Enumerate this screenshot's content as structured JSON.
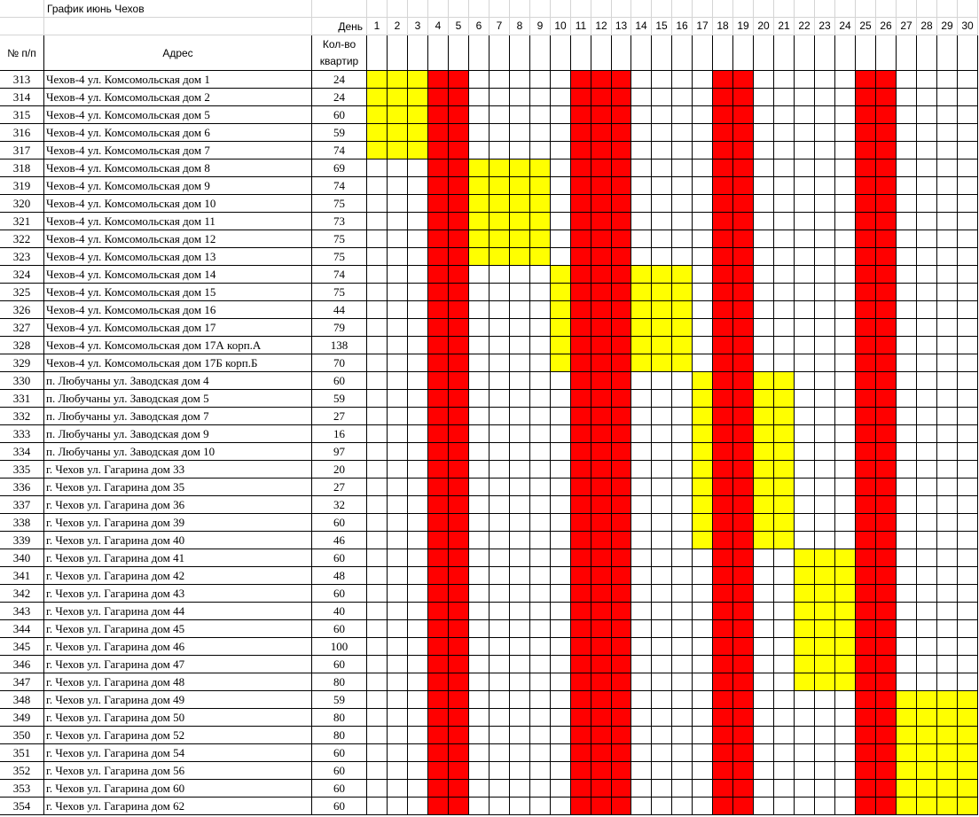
{
  "sheet": {
    "title": "График июнь Чехов",
    "header": {
      "day_label": "День",
      "num_label": "№ п/п",
      "address_label": "Адрес",
      "count_label_1": "Кол-во",
      "count_label_2": "квартир"
    },
    "days": [
      1,
      2,
      3,
      4,
      5,
      6,
      7,
      8,
      9,
      10,
      11,
      12,
      13,
      14,
      15,
      16,
      17,
      18,
      19,
      20,
      21,
      22,
      23,
      24,
      25,
      26,
      27,
      28,
      29,
      30
    ],
    "day_off_days": [
      4,
      5,
      11,
      12,
      13,
      18,
      19,
      25,
      26
    ],
    "colors": {
      "scheduled": "#ffff00",
      "day_off": "#ff0000",
      "gridline": "#d4d4d4",
      "border": "#000000"
    },
    "rows": [
      {
        "num": "313",
        "address": "Чехов-4 ул. Комсомольская дом 1",
        "count": "24",
        "days": [
          1,
          2,
          3
        ]
      },
      {
        "num": "314",
        "address": "Чехов-4 ул. Комсомольская дом 2",
        "count": "24",
        "days": [
          1,
          2,
          3
        ]
      },
      {
        "num": "315",
        "address": "Чехов-4 ул. Комсомольская дом 5",
        "count": "60",
        "days": [
          1,
          2,
          3
        ]
      },
      {
        "num": "316",
        "address": "Чехов-4 ул. Комсомольская дом 6",
        "count": "59",
        "days": [
          1,
          2,
          3
        ]
      },
      {
        "num": "317",
        "address": "Чехов-4 ул. Комсомольская дом 7",
        "count": "74",
        "days": [
          1,
          2,
          3
        ]
      },
      {
        "num": "318",
        "address": "Чехов-4 ул. Комсомольская дом 8",
        "count": "69",
        "days": [
          6,
          7,
          8,
          9
        ]
      },
      {
        "num": "319",
        "address": "Чехов-4 ул. Комсомольская дом 9",
        "count": "74",
        "days": [
          6,
          7,
          8,
          9
        ]
      },
      {
        "num": "320",
        "address": "Чехов-4 ул. Комсомольская дом 10",
        "count": "75",
        "days": [
          6,
          7,
          8,
          9
        ]
      },
      {
        "num": "321",
        "address": "Чехов-4 ул. Комсомольская дом 11",
        "count": "73",
        "days": [
          6,
          7,
          8,
          9
        ]
      },
      {
        "num": "322",
        "address": "Чехов-4 ул. Комсомольская дом 12",
        "count": "75",
        "days": [
          6,
          7,
          8,
          9
        ]
      },
      {
        "num": "323",
        "address": "Чехов-4 ул. Комсомольская дом 13",
        "count": "75",
        "days": [
          6,
          7,
          8,
          9
        ]
      },
      {
        "num": "324",
        "address": "Чехов-4 ул. Комсомольская дом 14",
        "count": "74",
        "days": [
          10,
          14,
          15,
          16
        ]
      },
      {
        "num": "325",
        "address": "Чехов-4 ул. Комсомольская дом 15",
        "count": "75",
        "days": [
          10,
          14,
          15,
          16
        ]
      },
      {
        "num": "326",
        "address": "Чехов-4 ул. Комсомольская дом 16",
        "count": "44",
        "days": [
          10,
          14,
          15,
          16
        ]
      },
      {
        "num": "327",
        "address": "Чехов-4 ул. Комсомольская дом 17",
        "count": "79",
        "days": [
          10,
          14,
          15,
          16
        ]
      },
      {
        "num": "328",
        "address": "Чехов-4 ул. Комсомольская дом 17А корп.А",
        "count": "138",
        "days": [
          10,
          14,
          15,
          16
        ]
      },
      {
        "num": "329",
        "address": "Чехов-4 ул. Комсомольская дом 17Б корп.Б",
        "count": "70",
        "days": [
          10,
          14,
          15,
          16
        ]
      },
      {
        "num": "330",
        "address": "п. Любучаны ул. Заводская дом 4",
        "count": "60",
        "days": [
          17,
          20,
          21
        ]
      },
      {
        "num": "331",
        "address": "п. Любучаны ул. Заводская дом 5",
        "count": "59",
        "days": [
          17,
          20,
          21
        ]
      },
      {
        "num": "332",
        "address": "п. Любучаны ул. Заводская дом 7",
        "count": "27",
        "days": [
          17,
          20,
          21
        ]
      },
      {
        "num": "333",
        "address": "п. Любучаны ул. Заводская дом 9",
        "count": "16",
        "days": [
          17,
          20,
          21
        ]
      },
      {
        "num": "334",
        "address": "п. Любучаны ул. Заводская дом 10",
        "count": "97",
        "days": [
          17,
          20,
          21
        ]
      },
      {
        "num": "335",
        "address": "г. Чехов ул. Гагарина дом 33",
        "count": "20",
        "days": [
          17,
          20,
          21
        ]
      },
      {
        "num": "336",
        "address": "г. Чехов ул. Гагарина дом 35",
        "count": "27",
        "days": [
          17,
          20,
          21
        ]
      },
      {
        "num": "337",
        "address": "г. Чехов ул. Гагарина дом 36",
        "count": "32",
        "days": [
          17,
          20,
          21
        ]
      },
      {
        "num": "338",
        "address": "г. Чехов ул. Гагарина дом 39",
        "count": "60",
        "days": [
          17,
          20,
          21
        ]
      },
      {
        "num": "339",
        "address": "г. Чехов ул. Гагарина дом 40",
        "count": "46",
        "days": [
          17,
          20,
          21
        ]
      },
      {
        "num": "340",
        "address": "г. Чехов ул. Гагарина дом 41",
        "count": "60",
        "days": [
          22,
          23,
          24
        ]
      },
      {
        "num": "341",
        "address": "г. Чехов ул. Гагарина дом 42",
        "count": "48",
        "days": [
          22,
          23,
          24
        ]
      },
      {
        "num": "342",
        "address": "г. Чехов ул. Гагарина дом 43",
        "count": "60",
        "days": [
          22,
          23,
          24
        ]
      },
      {
        "num": "343",
        "address": "г. Чехов ул. Гагарина дом 44",
        "count": "40",
        "days": [
          22,
          23,
          24
        ]
      },
      {
        "num": "344",
        "address": "г. Чехов ул. Гагарина дом 45",
        "count": "60",
        "days": [
          22,
          23,
          24
        ]
      },
      {
        "num": "345",
        "address": "г. Чехов ул. Гагарина дом 46",
        "count": "100",
        "days": [
          22,
          23,
          24
        ]
      },
      {
        "num": "346",
        "address": "г. Чехов ул. Гагарина дом 47",
        "count": "60",
        "days": [
          22,
          23,
          24
        ]
      },
      {
        "num": "347",
        "address": "г. Чехов ул. Гагарина дом 48",
        "count": "80",
        "days": [
          22,
          23,
          24
        ]
      },
      {
        "num": "348",
        "address": "г. Чехов ул. Гагарина дом 49",
        "count": "59",
        "days": [
          27,
          28,
          29,
          30
        ]
      },
      {
        "num": "349",
        "address": "г. Чехов ул. Гагарина дом 50",
        "count": "80",
        "days": [
          27,
          28,
          29,
          30
        ]
      },
      {
        "num": "350",
        "address": "г. Чехов ул. Гагарина дом 52",
        "count": "80",
        "days": [
          27,
          28,
          29,
          30
        ]
      },
      {
        "num": "351",
        "address": "г. Чехов ул. Гагарина дом 54",
        "count": "60",
        "days": [
          27,
          28,
          29,
          30
        ]
      },
      {
        "num": "352",
        "address": "г. Чехов ул. Гагарина дом 56",
        "count": "60",
        "days": [
          27,
          28,
          29,
          30
        ]
      },
      {
        "num": "353",
        "address": "г. Чехов ул. Гагарина дом 60",
        "count": "60",
        "days": [
          27,
          28,
          29,
          30
        ]
      },
      {
        "num": "354",
        "address": "г. Чехов ул. Гагарина дом 62",
        "count": "60",
        "days": [
          27,
          28,
          29,
          30
        ]
      }
    ]
  }
}
